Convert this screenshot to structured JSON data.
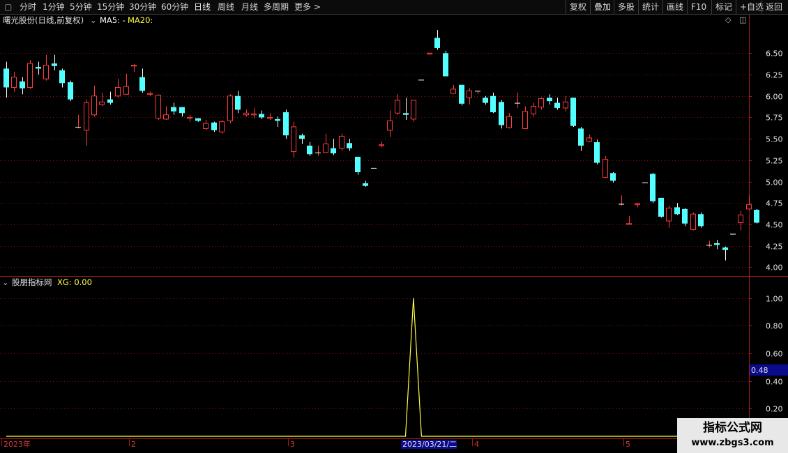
{
  "toolbar": {
    "left": [
      {
        "label": "分时"
      },
      {
        "label": "1分钟"
      },
      {
        "label": "5分钟"
      },
      {
        "label": "15分钟"
      },
      {
        "label": "30分钟"
      },
      {
        "label": "60分钟"
      },
      {
        "label": "日线",
        "active": true
      },
      {
        "label": "周线"
      },
      {
        "label": "月线"
      },
      {
        "label": "多周期"
      },
      {
        "label": "更多 >"
      }
    ],
    "right": [
      {
        "label": "复权"
      },
      {
        "label": "叠加"
      },
      {
        "label": "多股"
      },
      {
        "label": "统计"
      },
      {
        "label": "画线"
      },
      {
        "label": "F10"
      },
      {
        "label": "标记"
      },
      {
        "label": "+自选"
      },
      {
        "label": "返回"
      }
    ]
  },
  "main_title": {
    "stock": "曙光股份(日线,前复权)",
    "ma5": "MA5: -",
    "ma20": "MA20:"
  },
  "indicator_title": {
    "name": "股朋指标网",
    "value": "XG: 0.00"
  },
  "value_tag": "0.48",
  "time_labels": [
    "2023年",
    "2",
    "3",
    "4",
    "5"
  ],
  "cursor_date": "2023/03/21/二",
  "watermark": {
    "title": "指标公式网",
    "url": "www.zbgs3.com"
  },
  "colors": {
    "up": "#ff3b3b",
    "down": "#54ffff",
    "indicator": "#ffff44",
    "grid": "#7a1212",
    "axis": "#a51a1a"
  },
  "chart_data": [
    {
      "type": "candlestick",
      "title": "曙光股份(日线,前复权)",
      "ylim": [
        3.93,
        6.82
      ],
      "yticks": [
        4.0,
        4.25,
        4.5,
        4.75,
        5.0,
        5.25,
        5.5,
        5.75,
        6.0,
        6.25,
        6.5
      ],
      "x_labels": [
        "2023年",
        "2",
        "3",
        "4",
        "5"
      ],
      "candles": [
        [
          6.32,
          6.1,
          6.4,
          5.98
        ],
        [
          6.1,
          6.22,
          6.28,
          6.05
        ],
        [
          6.17,
          6.09,
          6.22,
          6.02
        ],
        [
          6.1,
          6.38,
          6.42,
          6.08
        ],
        [
          6.34,
          6.32,
          6.4,
          6.25
        ],
        [
          6.2,
          6.36,
          6.48,
          6.18
        ],
        [
          6.38,
          6.35,
          6.48,
          6.3
        ],
        [
          6.3,
          6.15,
          6.32,
          6.1
        ],
        [
          6.16,
          5.96,
          6.18,
          5.94
        ],
        [
          5.64,
          5.64,
          5.78,
          5.62
        ],
        [
          5.6,
          5.92,
          5.96,
          5.42
        ],
        [
          5.78,
          6.0,
          6.12,
          5.76
        ],
        [
          5.9,
          5.93,
          6.04,
          5.88
        ],
        [
          5.96,
          5.92,
          6.05,
          5.9
        ],
        [
          6.0,
          6.1,
          6.2,
          5.98
        ],
        [
          6.02,
          6.11,
          6.26,
          6.02
        ],
        [
          6.35,
          6.36,
          6.37,
          6.28
        ],
        [
          6.22,
          6.06,
          6.32,
          6.04
        ],
        [
          6.02,
          6.03,
          6.05,
          6.0
        ],
        [
          5.74,
          6.01,
          6.02,
          5.72
        ],
        [
          5.73,
          5.78,
          5.88,
          5.72
        ],
        [
          5.87,
          5.82,
          5.92,
          5.78
        ],
        [
          5.87,
          5.8,
          5.84,
          5.76
        ],
        [
          5.74,
          5.75,
          5.78,
          5.7
        ],
        [
          5.74,
          5.71,
          5.74,
          5.7
        ],
        [
          5.62,
          5.68,
          5.72,
          5.6
        ],
        [
          5.69,
          5.6,
          5.7,
          5.58
        ],
        [
          5.58,
          5.7,
          5.72,
          5.56
        ],
        [
          5.71,
          6.0,
          6.02,
          5.68
        ],
        [
          6.0,
          5.84,
          6.06,
          5.8
        ],
        [
          5.78,
          5.8,
          5.84,
          5.76
        ],
        [
          5.78,
          5.79,
          5.86,
          5.74
        ],
        [
          5.79,
          5.75,
          5.83,
          5.73
        ],
        [
          5.74,
          5.75,
          5.8,
          5.72
        ],
        [
          5.73,
          5.71,
          5.76,
          5.64
        ],
        [
          5.81,
          5.54,
          5.84,
          5.5
        ],
        [
          5.35,
          5.64,
          5.7,
          5.28
        ],
        [
          5.54,
          5.5,
          5.56,
          5.44
        ],
        [
          5.42,
          5.32,
          5.46,
          5.3
        ],
        [
          5.34,
          5.34,
          5.42,
          5.3
        ],
        [
          5.34,
          5.44,
          5.56,
          5.34
        ],
        [
          5.39,
          5.33,
          5.5,
          5.31
        ],
        [
          5.39,
          5.53,
          5.56,
          5.36
        ],
        [
          5.45,
          5.39,
          5.5,
          5.36
        ],
        [
          5.29,
          5.11,
          5.29,
          5.08
        ],
        [
          4.98,
          4.95,
          5.01,
          4.94
        ],
        [
          5.16,
          5.16,
          5.16,
          5.16
        ],
        [
          5.42,
          5.43,
          5.47,
          5.4
        ],
        [
          5.6,
          5.71,
          5.83,
          5.52
        ],
        [
          5.8,
          5.95,
          6.02,
          5.78
        ],
        [
          5.8,
          5.78,
          5.98,
          5.72
        ],
        [
          5.73,
          5.95,
          5.95,
          5.7
        ],
        [
          6.19,
          6.19,
          6.19,
          6.19
        ],
        [
          6.49,
          6.5,
          6.5,
          6.48
        ],
        [
          6.68,
          6.56,
          6.77,
          6.54
        ],
        [
          6.5,
          6.23,
          6.53,
          6.23
        ],
        [
          6.03,
          6.08,
          6.13,
          6.03
        ],
        [
          6.13,
          5.91,
          6.13,
          5.89
        ],
        [
          5.98,
          6.06,
          6.09,
          5.9
        ],
        [
          6.06,
          6.06,
          6.06,
          6.02
        ],
        [
          5.98,
          5.92,
          6.0,
          5.9
        ],
        [
          6.0,
          5.81,
          6.04,
          5.8
        ],
        [
          5.93,
          5.66,
          5.95,
          5.62
        ],
        [
          5.63,
          5.76,
          5.8,
          5.62
        ],
        [
          5.92,
          5.92,
          6.04,
          5.86
        ],
        [
          5.62,
          5.82,
          5.88,
          5.62
        ],
        [
          5.79,
          5.88,
          5.92,
          5.76
        ],
        [
          5.87,
          5.97,
          5.98,
          5.84
        ],
        [
          5.98,
          5.94,
          6.02,
          5.9
        ],
        [
          5.92,
          5.86,
          5.98,
          5.84
        ],
        [
          5.86,
          5.93,
          6.0,
          5.82
        ],
        [
          5.98,
          5.65,
          5.98,
          5.64
        ],
        [
          5.62,
          5.42,
          5.64,
          5.36
        ],
        [
          5.47,
          5.51,
          5.55,
          5.46
        ],
        [
          5.46,
          5.22,
          5.49,
          5.2
        ],
        [
          5.05,
          5.26,
          5.3,
          5.04
        ],
        [
          5.1,
          5.01,
          5.11,
          4.99
        ],
        [
          4.74,
          4.74,
          4.84,
          4.72
        ],
        [
          4.5,
          4.51,
          4.6,
          4.5
        ],
        [
          4.73,
          4.74,
          4.75,
          4.7
        ],
        [
          4.99,
          4.99,
          4.99,
          4.99
        ],
        [
          5.09,
          4.77,
          5.1,
          4.75
        ],
        [
          4.81,
          4.59,
          4.81,
          4.58
        ],
        [
          4.54,
          4.69,
          4.72,
          4.46
        ],
        [
          4.7,
          4.62,
          4.75,
          4.61
        ],
        [
          4.68,
          4.51,
          4.69,
          4.48
        ],
        [
          4.44,
          4.62,
          4.64,
          4.43
        ],
        [
          4.62,
          4.48,
          4.64,
          4.46
        ],
        [
          4.26,
          4.26,
          4.31,
          4.23
        ],
        [
          4.28,
          4.26,
          4.32,
          4.21
        ],
        [
          4.23,
          4.2,
          4.24,
          4.08
        ],
        [
          4.39,
          4.39,
          4.39,
          4.39
        ],
        [
          4.52,
          4.61,
          4.66,
          4.43
        ],
        [
          4.68,
          4.73,
          4.84,
          4.67
        ],
        [
          4.67,
          4.52,
          4.68,
          4.51
        ]
      ]
    },
    {
      "type": "line",
      "title": "股朋指标网",
      "series": [
        {
          "name": "XG",
          "values": [
            0,
            0,
            0,
            0,
            0,
            0,
            0,
            0,
            0,
            0,
            0,
            0,
            0,
            0,
            0,
            0,
            0,
            0,
            0,
            0,
            0,
            0,
            0,
            0,
            0,
            0,
            0,
            0,
            0,
            0,
            0,
            0,
            0,
            0,
            0,
            0,
            0,
            0,
            0,
            0,
            0,
            0,
            0,
            0,
            0,
            0,
            0,
            0,
            0,
            0,
            0,
            1,
            0,
            0,
            0,
            0,
            0,
            0,
            0,
            0,
            0,
            0,
            0,
            0,
            0,
            0,
            0,
            0,
            0,
            0,
            0,
            0,
            0,
            0,
            0,
            0,
            0,
            0,
            0,
            0,
            0,
            0,
            0,
            0,
            0,
            0,
            0,
            0,
            0,
            0,
            0,
            0,
            0,
            0,
            0,
            0
          ]
        }
      ],
      "ylim": [
        0,
        1.1
      ],
      "yticks": [
        0.2,
        0.4,
        0.6,
        0.8,
        1.0
      ]
    }
  ]
}
